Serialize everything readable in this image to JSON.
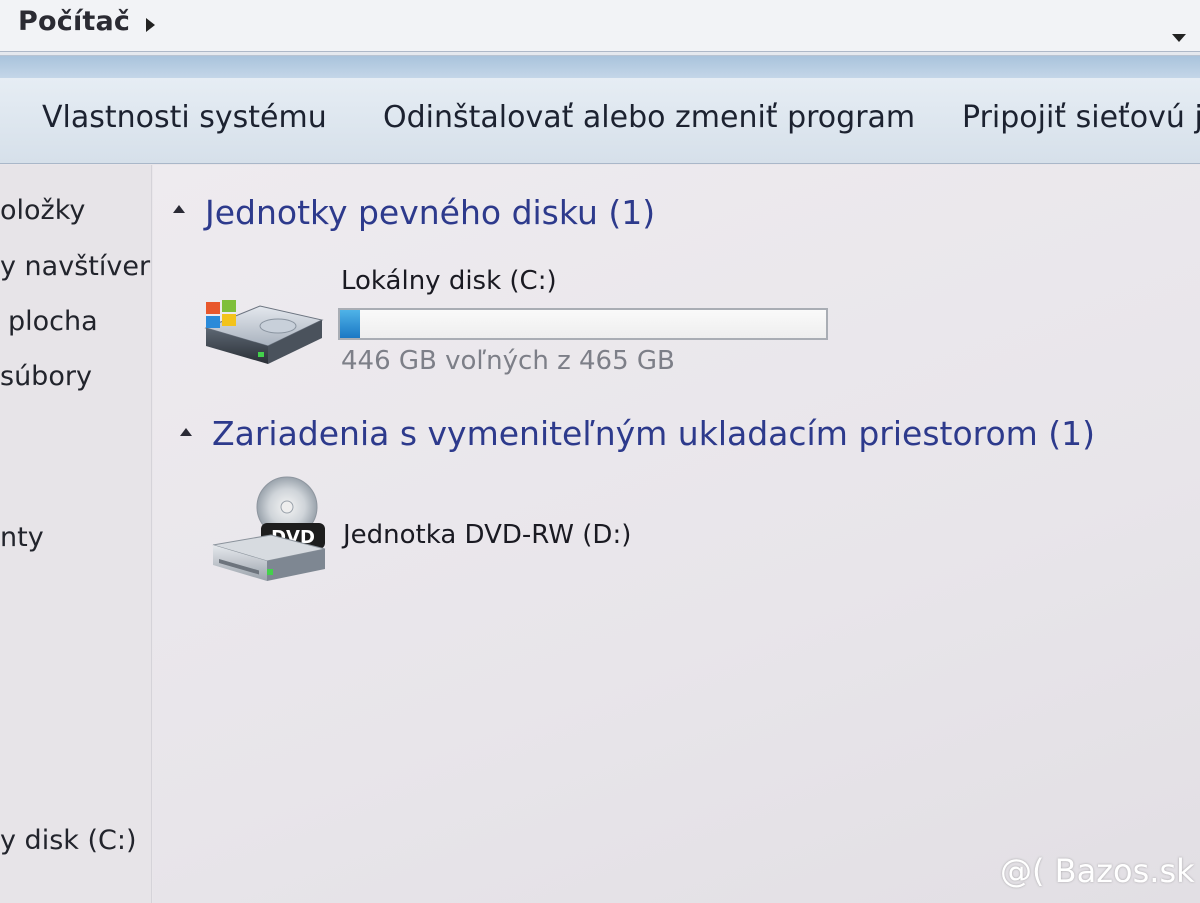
{
  "address_bar": {
    "crumb": "Počítač"
  },
  "toolbar": {
    "items": [
      {
        "label": "Vlastnosti systému"
      },
      {
        "label": "Odinštalovať alebo zmeniť program"
      },
      {
        "label": "Pripojiť sieťovú je"
      }
    ]
  },
  "nav": {
    "items": [
      {
        "label": "oložky"
      },
      {
        "label": "y navštíver"
      },
      {
        "label": "plocha"
      },
      {
        "label": "súbory"
      },
      {
        "label": "nty"
      },
      {
        "label": "y disk (C:)"
      }
    ]
  },
  "groups": {
    "hard_disks": {
      "title": "Jednotky pevného disku (1)",
      "drives": [
        {
          "name": "Lokálny disk (C:)",
          "free_text": "446 GB voľných z 465 GB",
          "used_fraction": 0.041,
          "icon": "windows-hard-drive-icon"
        }
      ]
    },
    "removable": {
      "title": "Zariadenia s vymeniteľným ukladacím priestorom (1)",
      "drives": [
        {
          "name": "Jednotka DVD-RW (D:)",
          "icon": "dvd-drive-icon",
          "icon_label": "DVD"
        }
      ]
    }
  },
  "watermark": "@( Bazos.sk",
  "colors": {
    "group_title": "#2d3a8c",
    "bar_fill": "#1b78c4",
    "toolbar_bg": "#dde6ef"
  }
}
